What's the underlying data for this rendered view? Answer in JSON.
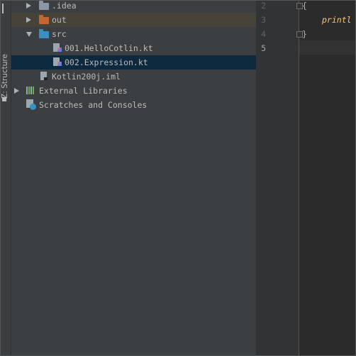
{
  "side_strip": {
    "label": "Z: Structure"
  },
  "project_tree": {
    "items": [
      {
        "label": ".idea",
        "kind": "folder",
        "folder_color": "#8a98a5",
        "expanded": false
      },
      {
        "label": "out",
        "kind": "folder",
        "folder_color": "#c4672f",
        "expanded": false
      },
      {
        "label": "src",
        "kind": "folder",
        "folder_color": "#3b8ec2",
        "expanded": true
      },
      {
        "label": "001.HelloCotlin.kt",
        "kind": "kotlin-file"
      },
      {
        "label": "002.Expression.kt",
        "kind": "kotlin-file",
        "selected": true
      },
      {
        "label": "Kotlin200j.iml",
        "kind": "iml-file"
      },
      {
        "label": "External Libraries",
        "kind": "libraries",
        "expanded": false
      },
      {
        "label": "Scratches and Consoles",
        "kind": "scratches"
      }
    ]
  },
  "editor": {
    "line_numbers": [
      "2",
      "3",
      "4",
      "5"
    ],
    "lines": [
      "{",
      "printl",
      "}",
      ""
    ]
  }
}
